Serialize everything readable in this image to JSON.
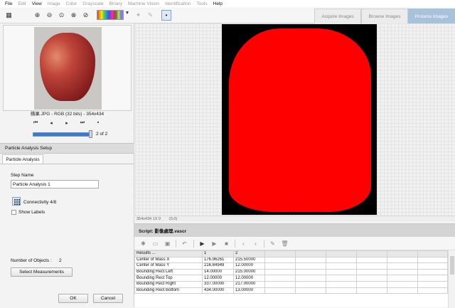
{
  "menu": [
    "File",
    "Edit",
    "View",
    "Image",
    "Color",
    "Grayscale",
    "Binary",
    "Machine Vision",
    "Identification",
    "Tools",
    "Help"
  ],
  "tabs": {
    "acquire": "Acquire Images",
    "browse": "Browse Images",
    "process": "Process Images"
  },
  "browser": {
    "caption": "蘋果.JPG - RGB (32 bits) - 354x434",
    "page": "2 of 2",
    "progress": 1.0
  },
  "setup": {
    "title": "Particle Analysis Setup",
    "tab": "Particle Analysis",
    "step_name_label": "Step Name",
    "step_name": "Particle Analysis 1",
    "connectivity": "Connectivity 4/8",
    "show_labels": "Show Labels",
    "objects_label": "Number of Objects :",
    "objects_value": "2",
    "select_button": "Select Measurements",
    "ok": "OK",
    "cancel": "Cancel"
  },
  "status": {
    "size": "354x434 1X 0",
    "coords": "(0,0)"
  },
  "script": {
    "title": "Script: 影像處理.vascr"
  },
  "results": {
    "headers": [
      "Results ...",
      "1",
      "2"
    ],
    "rows": [
      [
        "Center of Mass X",
        "176.96261",
        "215.50000"
      ],
      [
        "Center of Mass Y",
        "216.84949",
        "12.00000"
      ],
      [
        "Bounding Rect Left",
        "14.00000",
        "215.00000"
      ],
      [
        "Bounding Rect Top",
        "12.00000",
        "12.00000"
      ],
      [
        "Bounding Rect Right",
        "337.00000",
        "217.00000"
      ],
      [
        "Bounding Rect Bottom",
        "434.00000",
        "13.00000"
      ]
    ]
  },
  "icons": [
    "zoom-in-icon",
    "zoom-out-icon",
    "zoom-fit-icon",
    "zoom-fill-icon",
    "lookup-table-icon",
    "picker-icon",
    "select-icon",
    "star-icon",
    "folder-icon",
    "save-icon",
    "undo-icon",
    "run-step-icon",
    "play-icon",
    "stop-icon",
    "prev-icon",
    "next-icon",
    "edit-icon",
    "delete-icon"
  ]
}
